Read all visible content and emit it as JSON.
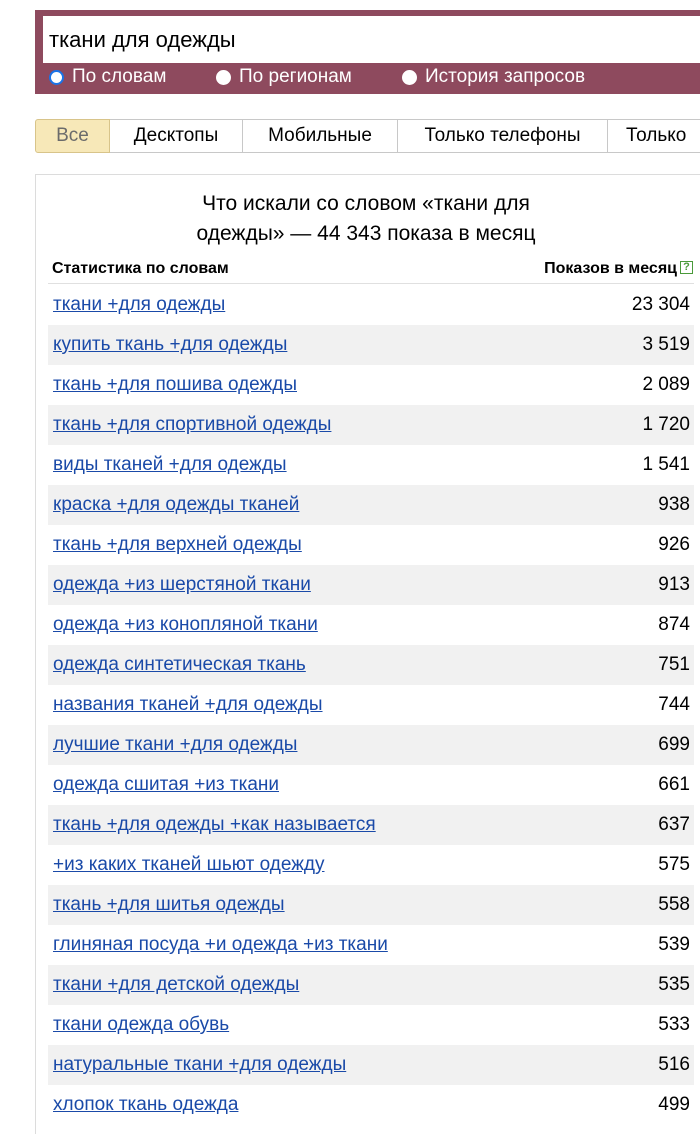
{
  "search": {
    "query": "ткани для одежды",
    "modes": [
      {
        "label": "По словам",
        "selected": true
      },
      {
        "label": "По регионам",
        "selected": false
      },
      {
        "label": "История запросов",
        "selected": false
      }
    ]
  },
  "tabs": [
    {
      "label": "Все",
      "active": true
    },
    {
      "label": "Десктопы",
      "active": false
    },
    {
      "label": "Мобильные",
      "active": false
    },
    {
      "label": "Только телефоны",
      "active": false
    },
    {
      "label": "Только",
      "active": false
    }
  ],
  "results": {
    "title_line1": "Что искали со словом «ткани для",
    "title_line2": "одежды» — 44 343 показа в месяц",
    "col_phrase": "Статистика по словам",
    "col_count": "Показов в месяц",
    "help_symbol": "?",
    "rows": [
      {
        "phrase": "ткани +для одежды",
        "count": "23 304"
      },
      {
        "phrase": "купить ткань +для одежды",
        "count": "3 519"
      },
      {
        "phrase": "ткань +для пошива одежды",
        "count": "2 089"
      },
      {
        "phrase": "ткань +для спортивной одежды",
        "count": "1 720"
      },
      {
        "phrase": "виды тканей +для одежды",
        "count": "1 541"
      },
      {
        "phrase": "краска +для одежды тканей",
        "count": "938"
      },
      {
        "phrase": "ткань +для верхней одежды",
        "count": "926"
      },
      {
        "phrase": "одежда +из шерстяной ткани",
        "count": "913"
      },
      {
        "phrase": "одежда +из конопляной ткани",
        "count": "874"
      },
      {
        "phrase": "одежда синтетическая ткань",
        "count": "751"
      },
      {
        "phrase": "названия тканей +для одежды",
        "count": "744"
      },
      {
        "phrase": "лучшие ткани +для одежды",
        "count": "699"
      },
      {
        "phrase": "одежда сшитая +из ткани",
        "count": "661"
      },
      {
        "phrase": "ткань +для одежды +как называется",
        "count": "637"
      },
      {
        "phrase": "+из каких тканей шьют одежду",
        "count": "575"
      },
      {
        "phrase": "ткань +для шитья одежды",
        "count": "558"
      },
      {
        "phrase": "глиняная посуда +и одежда +из ткани",
        "count": "539"
      },
      {
        "phrase": "ткани +для детской одежды",
        "count": "535"
      },
      {
        "phrase": "ткани одежда обувь",
        "count": "533"
      },
      {
        "phrase": "натуральные ткани +для одежды",
        "count": "516"
      },
      {
        "phrase": "хлопок ткань одежда",
        "count": "499"
      }
    ]
  }
}
